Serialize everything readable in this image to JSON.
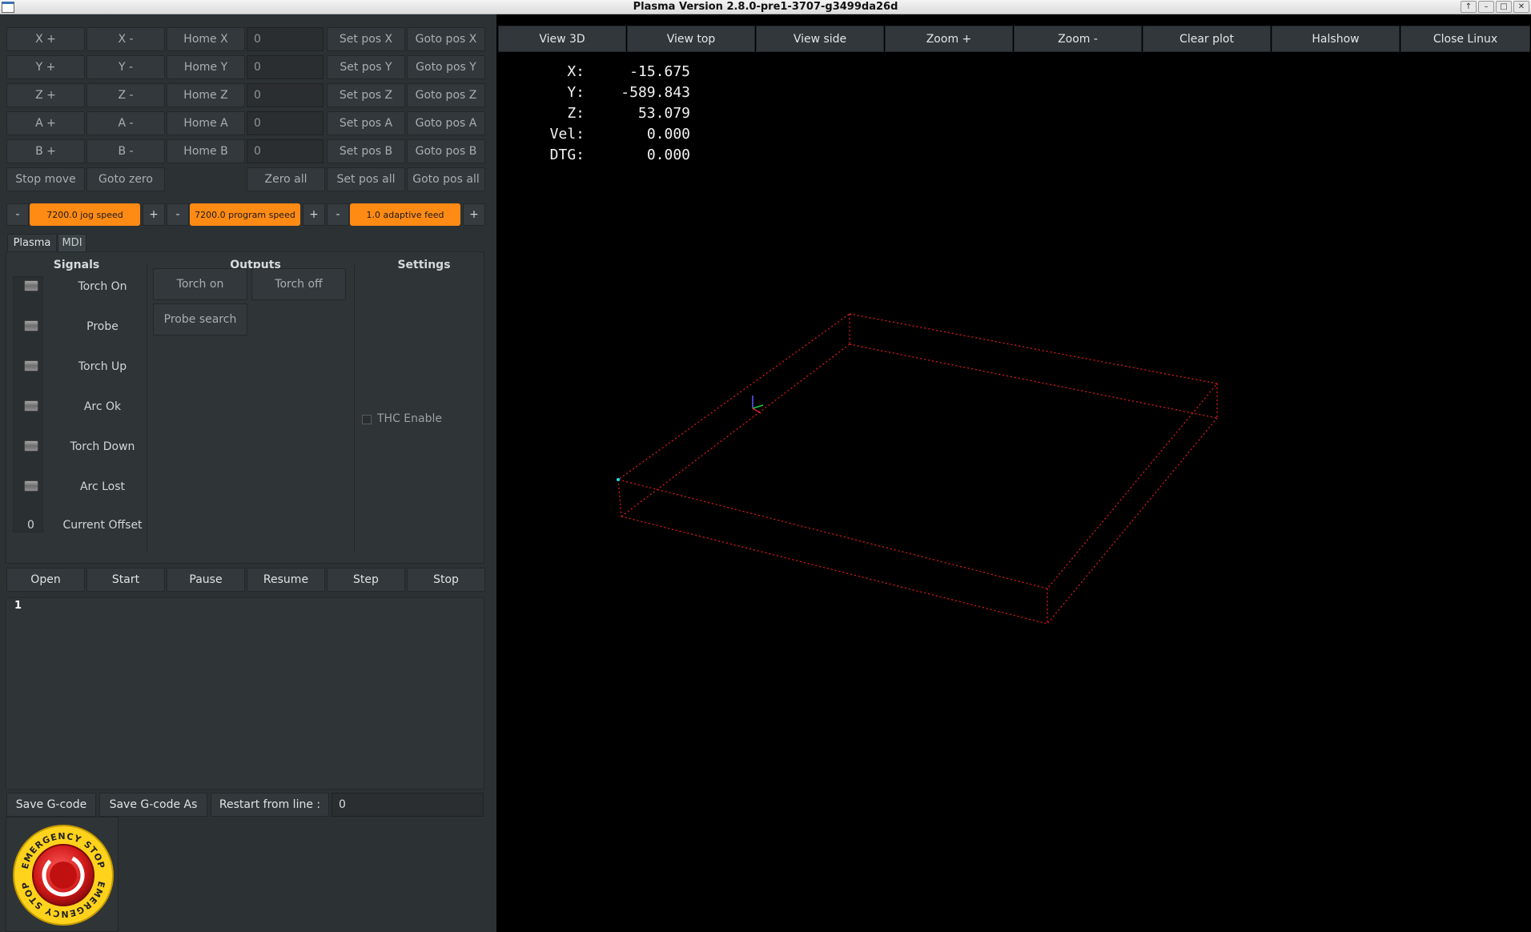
{
  "window": {
    "title": "Plasma Version 2.8.0-pre1-3707-g3499da26d",
    "controls": [
      "↑",
      "–",
      "□",
      "✕"
    ]
  },
  "axes": [
    {
      "plus": "X +",
      "minus": "X -",
      "home": "Home X",
      "value": "0",
      "setpos": "Set pos X",
      "gotopos": "Goto pos X"
    },
    {
      "plus": "Y +",
      "minus": "Y -",
      "home": "Home Y",
      "value": "0",
      "setpos": "Set pos Y",
      "gotopos": "Goto pos Y"
    },
    {
      "plus": "Z +",
      "minus": "Z -",
      "home": "Home Z",
      "value": "0",
      "setpos": "Set pos Z",
      "gotopos": "Goto pos Z"
    },
    {
      "plus": "A +",
      "minus": "A -",
      "home": "Home A",
      "value": "0",
      "setpos": "Set pos A",
      "gotopos": "Goto pos A"
    },
    {
      "plus": "B +",
      "minus": "B -",
      "home": "Home B",
      "value": "0",
      "setpos": "Set pos B",
      "gotopos": "Goto pos B"
    }
  ],
  "move_row": {
    "stop_move": "Stop move",
    "goto_zero": "Goto zero",
    "zero_all": "Zero all",
    "set_pos_all": "Set pos all",
    "goto_pos_all": "Goto pos all"
  },
  "speeds": {
    "minus": "-",
    "plus": "+",
    "jog": "7200.0 jog speed",
    "program": "7200.0 program speed",
    "adaptive": "1.0 adaptive feed",
    "accent_color": "#ff8a14"
  },
  "tabs": [
    {
      "label": "Plasma",
      "active": true
    },
    {
      "label": "MDI",
      "active": false
    }
  ],
  "plasma": {
    "signals_header": "Signals",
    "outputs_header": "Outputs",
    "settings_header": "Settings",
    "signals": [
      "Torch On",
      "Probe",
      "Torch Up",
      "Arc Ok",
      "Torch Down",
      "Arc Lost"
    ],
    "offset_value": "0",
    "offset_label": "Current Offset",
    "torch_on": "Torch on",
    "torch_off": "Torch off",
    "probe_search": "Probe search",
    "thc_enable": "THC Enable"
  },
  "program_controls": [
    "Open",
    "Start",
    "Pause",
    "Resume",
    "Step",
    "Stop"
  ],
  "gcode": {
    "first_line": "1"
  },
  "bottom": {
    "save": "Save G-code",
    "save_as": "Save G-code As",
    "restart_label": "Restart from line :",
    "restart_value": "0"
  },
  "estop": {
    "label": "EMERGENCY STOP"
  },
  "view_buttons": [
    "View 3D",
    "View top",
    "View side",
    "Zoom +",
    "Zoom -",
    "Clear plot",
    "Halshow",
    "Close Linux"
  ],
  "dro": [
    {
      "label": "X:",
      "value": "-15.675"
    },
    {
      "label": "Y:",
      "value": "-589.843"
    },
    {
      "label": "Z:",
      "value": "53.079"
    },
    {
      "label": "Vel:",
      "value": "0.000"
    },
    {
      "label": "DTG:",
      "value": "0.000"
    }
  ],
  "plot": {
    "boundary_color": "#d01818"
  }
}
